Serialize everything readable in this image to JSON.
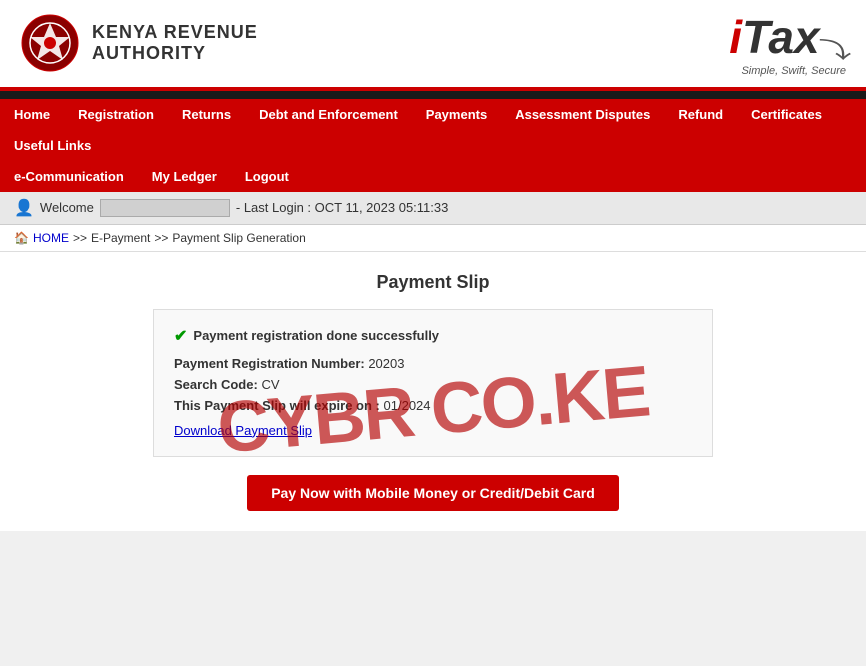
{
  "header": {
    "org_name_line1": "Kenya Revenue",
    "org_name_line2": "Authority",
    "itax_brand": "i",
    "itax_brand2": "Tax",
    "tagline": "Simple, Swift, Secure"
  },
  "navbar": {
    "row1": [
      {
        "id": "home",
        "label": "Home"
      },
      {
        "id": "registration",
        "label": "Registration"
      },
      {
        "id": "returns",
        "label": "Returns"
      },
      {
        "id": "debt-enforcement",
        "label": "Debt and Enforcement"
      },
      {
        "id": "payments",
        "label": "Payments"
      },
      {
        "id": "assessment-disputes",
        "label": "Assessment Disputes"
      },
      {
        "id": "refund",
        "label": "Refund"
      },
      {
        "id": "certificates",
        "label": "Certificates"
      },
      {
        "id": "useful-links",
        "label": "Useful Links"
      }
    ],
    "row2": [
      {
        "id": "e-communication",
        "label": "e-Communication"
      },
      {
        "id": "my-ledger",
        "label": "My Ledger"
      },
      {
        "id": "logout",
        "label": "Logout"
      }
    ]
  },
  "welcome_bar": {
    "welcome_label": "Welcome",
    "last_login_text": "- Last Login : OCT 11, 2023 05:11:33"
  },
  "breadcrumb": {
    "home": "HOME",
    "sep1": ">>",
    "epayment": "E-Payment",
    "sep2": ">>",
    "current": "Payment Slip Generation"
  },
  "page": {
    "title": "Payment Slip",
    "success_message": "Payment registration done successfully",
    "reg_number_label": "Payment Registration Number:",
    "reg_number_value": "20203",
    "search_code_label": "Search Code:",
    "search_code_value": "CV",
    "expiry_label": "This Payment Slip will expire on :",
    "expiry_value": "01/2024",
    "download_link": "Download Payment Slip",
    "pay_button": "Pay Now with Mobile Money or Credit/Debit Card"
  },
  "watermark": {
    "text": "CYBR CO.KE"
  }
}
